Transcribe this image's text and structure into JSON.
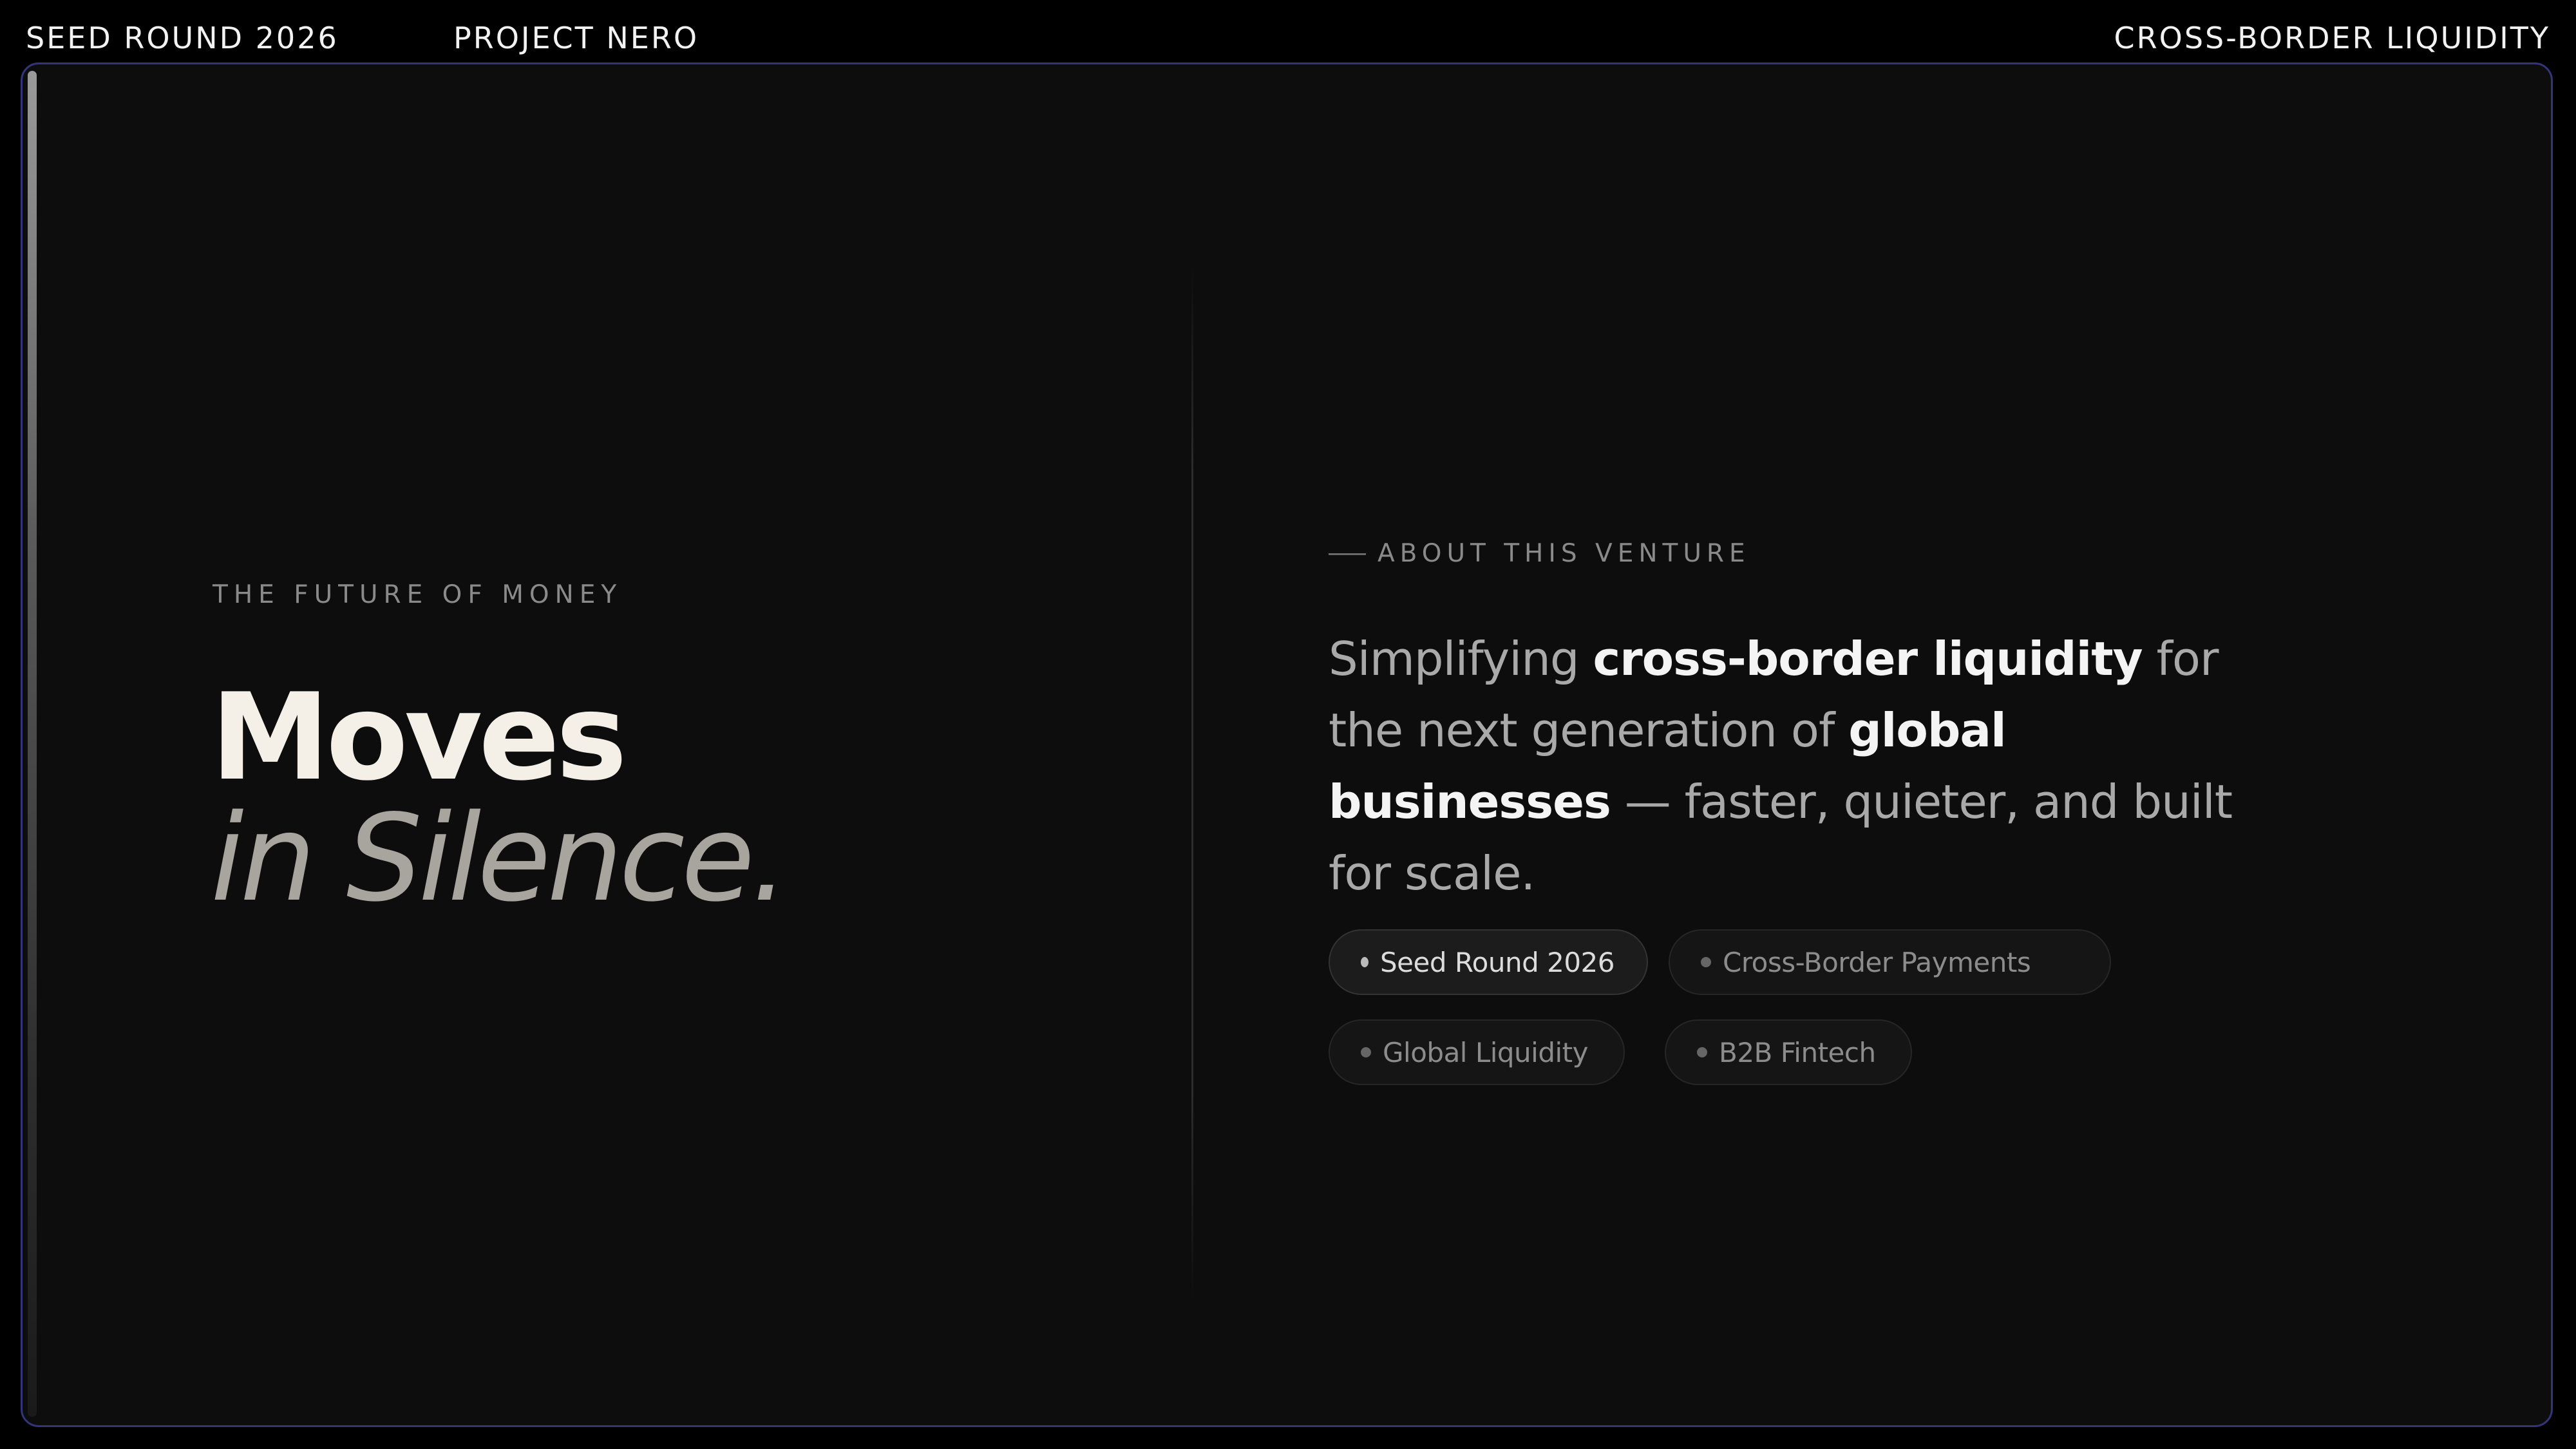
{
  "header": {
    "round_label": "SEED ROUND 2026",
    "project_label": "PROJECT NERO",
    "focus_label": "CROSS-BORDER LIQUIDITY"
  },
  "hero": {
    "eyebrow": "THE FUTURE OF MONEY",
    "headline_line1": "Moves",
    "headline_line2": "in Silence."
  },
  "about": {
    "section_label": "ABOUT THIS VENTURE",
    "lede": {
      "part1": "Simplifying ",
      "emphasis1": "cross-border liquidity",
      "part2": " for the next generation of ",
      "emphasis2": "global businesses",
      "part3": " — faster, quieter, and built for scale."
    },
    "tags": [
      {
        "label": "Seed Round 2026",
        "active": true
      },
      {
        "label": "Cross-Border Payments",
        "active": false
      },
      {
        "label": "Global Liquidity",
        "active": false
      },
      {
        "label": "B2B Fintech",
        "active": false
      }
    ]
  },
  "colors": {
    "background": "#000000",
    "card_background": "#0d0d0d",
    "card_border": "#34347a",
    "headline_primary": "#f4f0e8",
    "headline_secondary": "#a8a49e",
    "muted_text": "#8a8a8a"
  }
}
